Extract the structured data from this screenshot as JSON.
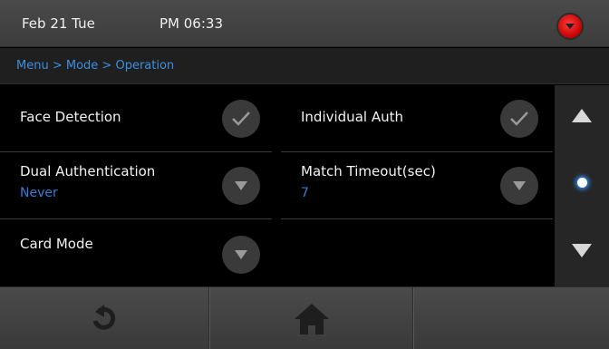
{
  "status": {
    "date": "Feb 21 Tue",
    "time": "PM 06:33"
  },
  "breadcrumb": {
    "menu": "Menu",
    "sep1": " > ",
    "mode": "Mode",
    "sep2": " > ",
    "operation": "Operation"
  },
  "settings": [
    {
      "label": "Face Detection",
      "value": "",
      "control": "check-icon"
    },
    {
      "label": "Individual Auth",
      "value": "",
      "control": "check-icon"
    },
    {
      "label": "Dual Authentication",
      "value": "Never",
      "control": "chevron-down-icon"
    },
    {
      "label": "Match Timeout(sec)",
      "value": "7",
      "control": "chevron-down-icon"
    },
    {
      "label": "Card Mode",
      "value": "",
      "control": "chevron-down-icon"
    }
  ],
  "colors": {
    "accent": "#3b8fe0",
    "alert": "#e00000",
    "panel": "#262626"
  },
  "navigation": {
    "page_indicator_icon": "dot-icon",
    "back_icon": "refresh-icon",
    "home_icon": "home-icon"
  }
}
